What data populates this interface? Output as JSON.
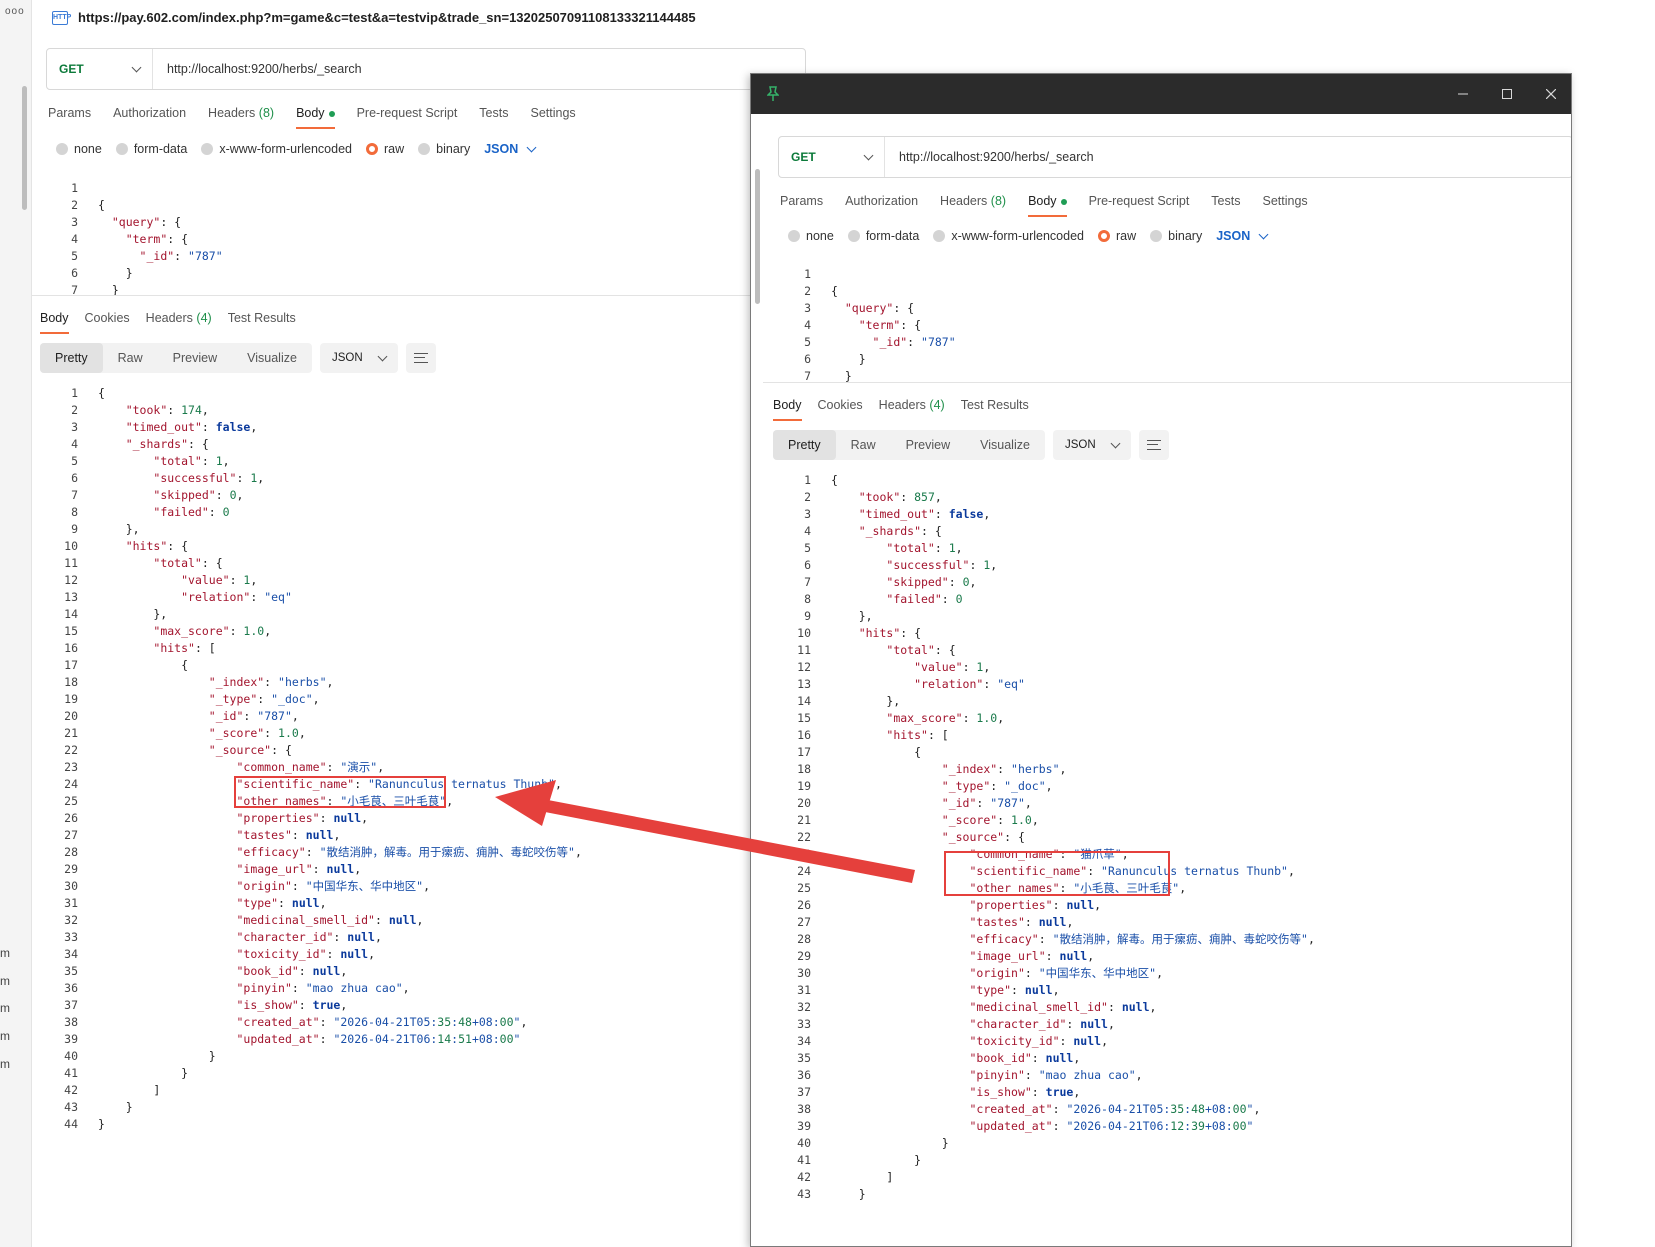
{
  "browser": {
    "dots": "ooo",
    "http_icon": "HTTP",
    "url": "https://pay.602.com/index.php?m=game&c=test&a=testvip&trade_sn=13202507091108133321144485",
    "side_labels": [
      "m",
      "m",
      "m",
      "m",
      "m"
    ]
  },
  "request": {
    "method": "GET",
    "url": "http://localhost:9200/herbs/_search",
    "tabs": [
      {
        "label": "Params"
      },
      {
        "label": "Authorization"
      },
      {
        "label": "Headers",
        "count": "(8)"
      },
      {
        "label": "Body",
        "active": true
      },
      {
        "label": "Pre-request Script"
      },
      {
        "label": "Tests"
      },
      {
        "label": "Settings"
      }
    ],
    "body_types": [
      "none",
      "form-data",
      "x-www-form-urlencoded",
      "raw",
      "binary"
    ],
    "body_type_selected": "raw",
    "format": "JSON",
    "body_lines": [
      {
        "n": "1",
        "t": ""
      },
      {
        "n": "2",
        "t": "{"
      },
      {
        "n": "3",
        "t": "  \"query\": {"
      },
      {
        "n": "4",
        "t": "    \"term\": {"
      },
      {
        "n": "5",
        "t": "      \"_id\": \"787\""
      },
      {
        "n": "6",
        "t": "    }"
      },
      {
        "n": "7",
        "t": "  }"
      }
    ]
  },
  "response": {
    "tabs": [
      {
        "label": "Body",
        "active": true
      },
      {
        "label": "Cookies"
      },
      {
        "label": "Headers",
        "count": "(4)"
      },
      {
        "label": "Test Results"
      }
    ],
    "views": [
      "Pretty",
      "Raw",
      "Preview",
      "Visualize"
    ],
    "view_selected": "Pretty",
    "format": "JSON"
  },
  "left_response_lines": [
    {
      "n": "1",
      "t": "{"
    },
    {
      "n": "2",
      "t": "    \"took\": 174,"
    },
    {
      "n": "3",
      "t": "    \"timed_out\": false,"
    },
    {
      "n": "4",
      "t": "    \"_shards\": {"
    },
    {
      "n": "5",
      "t": "        \"total\": 1,"
    },
    {
      "n": "6",
      "t": "        \"successful\": 1,"
    },
    {
      "n": "7",
      "t": "        \"skipped\": 0,"
    },
    {
      "n": "8",
      "t": "        \"failed\": 0"
    },
    {
      "n": "9",
      "t": "    },"
    },
    {
      "n": "10",
      "t": "    \"hits\": {"
    },
    {
      "n": "11",
      "t": "        \"total\": {"
    },
    {
      "n": "12",
      "t": "            \"value\": 1,"
    },
    {
      "n": "13",
      "t": "            \"relation\": \"eq\""
    },
    {
      "n": "14",
      "t": "        },"
    },
    {
      "n": "15",
      "t": "        \"max_score\": 1.0,"
    },
    {
      "n": "16",
      "t": "        \"hits\": ["
    },
    {
      "n": "17",
      "t": "            {"
    },
    {
      "n": "18",
      "t": "                \"_index\": \"herbs\","
    },
    {
      "n": "19",
      "t": "                \"_type\": \"_doc\","
    },
    {
      "n": "20",
      "t": "                \"_id\": \"787\","
    },
    {
      "n": "21",
      "t": "                \"_score\": 1.0,"
    },
    {
      "n": "22",
      "t": "                \"_source\": {"
    },
    {
      "n": "23",
      "t": "                    \"common_name\": \"演示\","
    },
    {
      "n": "24",
      "t": "                    \"scientific_name\": \"Ranunculus ternatus Thunb\","
    },
    {
      "n": "25",
      "t": "                    \"other_names\": \"小毛茛、三叶毛茛\","
    },
    {
      "n": "26",
      "t": "                    \"properties\": null,"
    },
    {
      "n": "27",
      "t": "                    \"tastes\": null,"
    },
    {
      "n": "28",
      "t": "                    \"efficacy\": \"散结消肿，解毒。用于瘰疬、痈肿、毒蛇咬伤等\","
    },
    {
      "n": "29",
      "t": "                    \"image_url\": null,"
    },
    {
      "n": "30",
      "t": "                    \"origin\": \"中国华东、华中地区\","
    },
    {
      "n": "31",
      "t": "                    \"type\": null,"
    },
    {
      "n": "32",
      "t": "                    \"medicinal_smell_id\": null,"
    },
    {
      "n": "33",
      "t": "                    \"character_id\": null,"
    },
    {
      "n": "34",
      "t": "                    \"toxicity_id\": null,"
    },
    {
      "n": "35",
      "t": "                    \"book_id\": null,"
    },
    {
      "n": "36",
      "t": "                    \"pinyin\": \"mao zhua cao\","
    },
    {
      "n": "37",
      "t": "                    \"is_show\": true,"
    },
    {
      "n": "38",
      "t": "                    \"created_at\": \"2026-04-21T05:35:48+08:00\","
    },
    {
      "n": "39",
      "t": "                    \"updated_at\": \"2026-04-21T06:14:51+08:00\""
    },
    {
      "n": "40",
      "t": "                }"
    },
    {
      "n": "41",
      "t": "            }"
    },
    {
      "n": "42",
      "t": "        ]"
    },
    {
      "n": "43",
      "t": "    }"
    },
    {
      "n": "44",
      "t": "}"
    }
  ],
  "right_response_lines": [
    {
      "n": "1",
      "t": "{"
    },
    {
      "n": "2",
      "t": "    \"took\": 857,"
    },
    {
      "n": "3",
      "t": "    \"timed_out\": false,"
    },
    {
      "n": "4",
      "t": "    \"_shards\": {"
    },
    {
      "n": "5",
      "t": "        \"total\": 1,"
    },
    {
      "n": "6",
      "t": "        \"successful\": 1,"
    },
    {
      "n": "7",
      "t": "        \"skipped\": 0,"
    },
    {
      "n": "8",
      "t": "        \"failed\": 0"
    },
    {
      "n": "9",
      "t": "    },"
    },
    {
      "n": "10",
      "t": "    \"hits\": {"
    },
    {
      "n": "11",
      "t": "        \"total\": {"
    },
    {
      "n": "12",
      "t": "            \"value\": 1,"
    },
    {
      "n": "13",
      "t": "            \"relation\": \"eq\""
    },
    {
      "n": "14",
      "t": "        },"
    },
    {
      "n": "15",
      "t": "        \"max_score\": 1.0,"
    },
    {
      "n": "16",
      "t": "        \"hits\": ["
    },
    {
      "n": "17",
      "t": "            {"
    },
    {
      "n": "18",
      "t": "                \"_index\": \"herbs\","
    },
    {
      "n": "19",
      "t": "                \"_type\": \"_doc\","
    },
    {
      "n": "20",
      "t": "                \"_id\": \"787\","
    },
    {
      "n": "21",
      "t": "                \"_score\": 1.0,"
    },
    {
      "n": "22",
      "t": "                \"_source\": {"
    },
    {
      "n": "23",
      "t": "                    \"common_name\": \"猫爪草\","
    },
    {
      "n": "24",
      "t": "                    \"scientific_name\": \"Ranunculus ternatus Thunb\","
    },
    {
      "n": "25",
      "t": "                    \"other_names\": \"小毛茛、三叶毛茛\","
    },
    {
      "n": "26",
      "t": "                    \"properties\": null,"
    },
    {
      "n": "27",
      "t": "                    \"tastes\": null,"
    },
    {
      "n": "28",
      "t": "                    \"efficacy\": \"散结消肿，解毒。用于瘰疬、痈肿、毒蛇咬伤等\","
    },
    {
      "n": "29",
      "t": "                    \"image_url\": null,"
    },
    {
      "n": "30",
      "t": "                    \"origin\": \"中国华东、华中地区\","
    },
    {
      "n": "31",
      "t": "                    \"type\": null,"
    },
    {
      "n": "32",
      "t": "                    \"medicinal_smell_id\": null,"
    },
    {
      "n": "33",
      "t": "                    \"character_id\": null,"
    },
    {
      "n": "34",
      "t": "                    \"toxicity_id\": null,"
    },
    {
      "n": "35",
      "t": "                    \"book_id\": null,"
    },
    {
      "n": "36",
      "t": "                    \"pinyin\": \"mao zhua cao\","
    },
    {
      "n": "37",
      "t": "                    \"is_show\": true,"
    },
    {
      "n": "38",
      "t": "                    \"created_at\": \"2026-04-21T05:35:48+08:00\","
    },
    {
      "n": "39",
      "t": "                    \"updated_at\": \"2026-04-21T06:12:39+08:00\""
    },
    {
      "n": "40",
      "t": "                }"
    },
    {
      "n": "41",
      "t": "            }"
    },
    {
      "n": "42",
      "t": "        ]"
    },
    {
      "n": "43",
      "t": "    }"
    }
  ],
  "window_controls": [
    "minimize-icon",
    "maximize-icon",
    "close-icon"
  ],
  "annotation_color": "#e5403c",
  "accent_color": "#f26b3a"
}
